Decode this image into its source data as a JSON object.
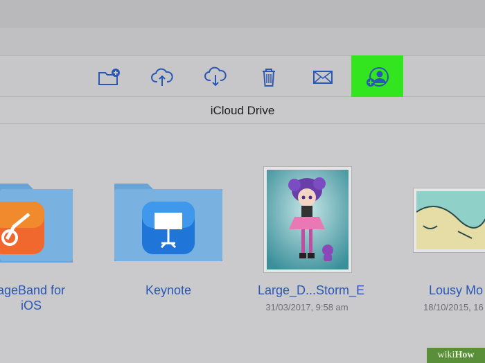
{
  "header": {
    "title": "iCloud Drive"
  },
  "toolbar": {
    "items": [
      {
        "icon": "new-folder-icon"
      },
      {
        "icon": "upload-icon"
      },
      {
        "icon": "download-icon"
      },
      {
        "icon": "trash-icon"
      },
      {
        "icon": "mail-icon"
      },
      {
        "icon": "share-person-icon"
      }
    ],
    "highlight_color": "#33e51e",
    "accent_color": "#2a57b4"
  },
  "files": [
    {
      "name": "GarageBand for iOS",
      "line1": "ageBand for",
      "line2": "iOS",
      "type": "folder"
    },
    {
      "name": "Keynote",
      "line1": "Keynote",
      "type": "folder"
    },
    {
      "name": "Large_D...Storm_E",
      "line1": "Large_D...Storm_E",
      "date": "31/03/2017, 9:58 am",
      "type": "image"
    },
    {
      "name": "Lousy Mo",
      "line1": "Lousy Mo",
      "date": "18/10/2015, 16",
      "type": "image"
    }
  ],
  "watermark": {
    "wiki": "wiki",
    "how": "How"
  }
}
